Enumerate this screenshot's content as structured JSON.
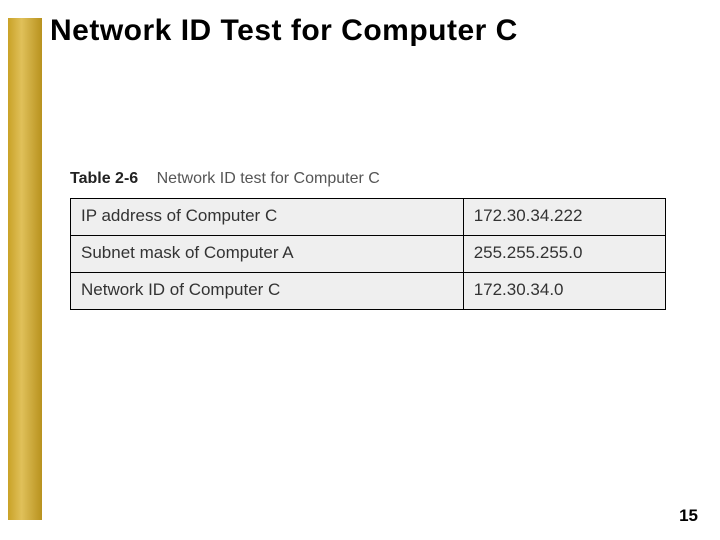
{
  "slide": {
    "title": "Network ID Test for Computer C",
    "page_number": "15"
  },
  "table": {
    "label": "Table 2-6",
    "title": "Network ID test for Computer C",
    "rows": [
      {
        "label": "IP address of Computer C",
        "value": "172.30.34.222"
      },
      {
        "label": "Subnet mask of Computer A",
        "value": "255.255.255.0"
      },
      {
        "label": "Network ID of Computer C",
        "value": "172.30.34.0"
      }
    ]
  }
}
